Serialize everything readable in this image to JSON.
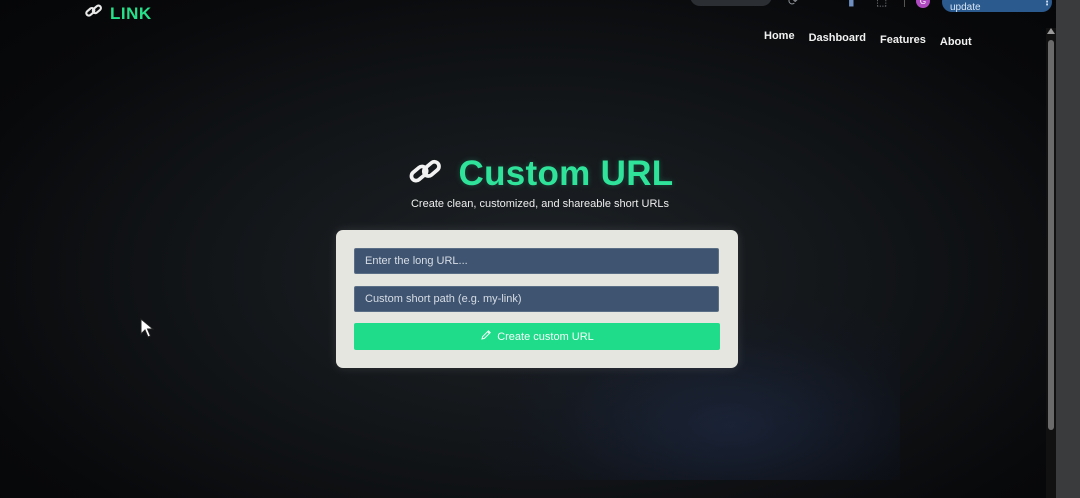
{
  "browser": {
    "relaunch_label": "Relaunch to update",
    "profile_initial": "G"
  },
  "header": {
    "logo_text": "LINK",
    "nav": [
      {
        "label": "Home"
      },
      {
        "label": "Dashboard"
      },
      {
        "label": "Features"
      },
      {
        "label": "About"
      }
    ]
  },
  "hero": {
    "title": "Custom URL",
    "subtitle": "Create clean, customized, and shareable short URLs"
  },
  "form": {
    "long_url_placeholder": "Enter the long URL...",
    "custom_path_placeholder": "Custom short path (e.g. my-link)",
    "submit_label": "Create custom URL"
  },
  "colors": {
    "accent": "#26e08a",
    "field_bg": "#3e5470",
    "card_bg": "#e6e6e0",
    "page_bg": "#0d0f11"
  },
  "icons": {
    "logo": "link-icon",
    "hero": "link-icon",
    "button": "pencil-icon"
  }
}
